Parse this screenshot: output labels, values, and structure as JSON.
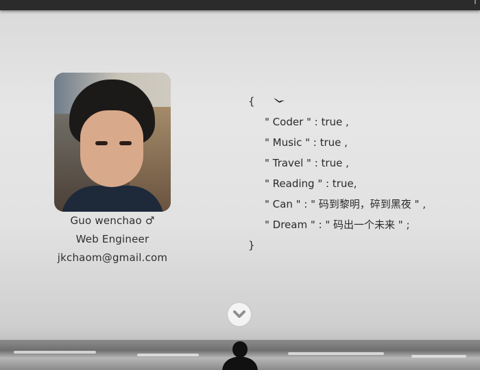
{
  "profile": {
    "name": "Guo wenchao ♂",
    "title": "Web Engineer",
    "email": "jkchaom@gmail.com"
  },
  "code": {
    "open_brace": "{",
    "lines": [
      "\" Coder \" : true ,",
      "\" Music \" : true ,",
      "\" Travel \" : true ,",
      "\" Reading \" : true,",
      "\" Can \" : \" 码到黎明，碎到黑夜 \" ,",
      "\" Dream \" : \" 码出一个未来 \" ;"
    ],
    "close_brace": "}"
  },
  "icons": {
    "scroll": "chevron-down-icon",
    "bird": "bird-icon"
  },
  "colors": {
    "topbar": "#2b2b2b",
    "text": "#2e2e2e"
  }
}
